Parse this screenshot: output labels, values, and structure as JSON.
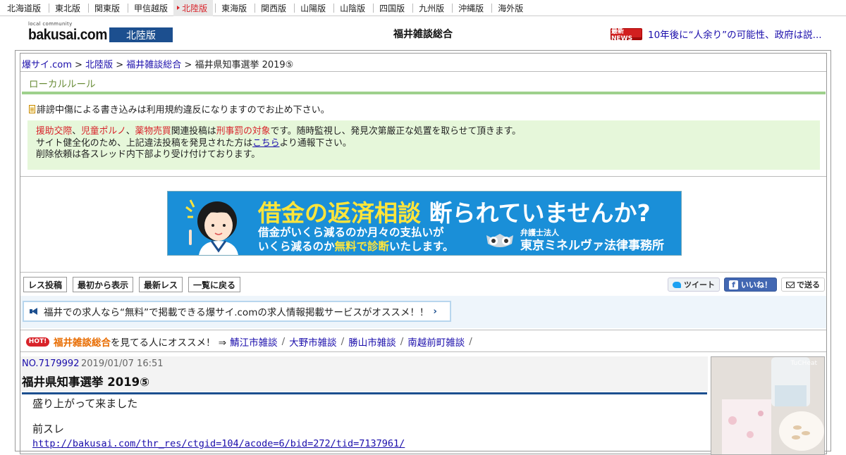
{
  "region_nav": [
    {
      "label": "北海道版",
      "active": false
    },
    {
      "label": "東北版",
      "active": false
    },
    {
      "label": "関東版",
      "active": false
    },
    {
      "label": "甲信越版",
      "active": false
    },
    {
      "label": "北陸版",
      "active": true
    },
    {
      "label": "東海版",
      "active": false
    },
    {
      "label": "関西版",
      "active": false
    },
    {
      "label": "山陽版",
      "active": false
    },
    {
      "label": "山陰版",
      "active": false
    },
    {
      "label": "四国版",
      "active": false
    },
    {
      "label": "九州版",
      "active": false
    },
    {
      "label": "沖縄版",
      "active": false
    },
    {
      "label": "海外版",
      "active": false
    }
  ],
  "header": {
    "logo_small": "local community",
    "logo_big": "bakusai.com",
    "region": "北陸版",
    "title": "福井雑談総合",
    "news_badge": "最新NEWS",
    "news_text": "10年後に“人余り”の可能性、政府は説..."
  },
  "breadcrumb": {
    "home": "爆サイ.com",
    "region": "北陸版",
    "board": "福井雑談総合",
    "sep": " > ",
    "current": "福井県知事選挙 2019⑤"
  },
  "local_rule": "ローカルルール",
  "notice": "誹謗中傷による書き込みは利用規約違反になりますのでお止め下さい。",
  "warning": {
    "w1": "援助交際",
    "comma1": "、",
    "w2": "児童ポルノ",
    "comma2": "、",
    "w3": "薬物売買",
    "mid": "関連投稿は",
    "w4": "刑事罰の対象",
    "tail": "です。随時監視し、発見次第厳正な処置を取らせて頂きます。",
    "line2_pre": "サイト健全化のため、上記違法投稿を発見された方は",
    "line2_link": "こちら",
    "line2_post": "より通報下さい。",
    "line3": "削除依頼は各スレッド内下部より受け付けております。"
  },
  "ad": {
    "head_yellow": "借金の返済相談",
    "head_white": "断られていませんか?",
    "sub1": "借金がいくら減るのか月々の支払いが",
    "sub2_pre": "いくら減るのか",
    "sub2_yellow": "無料で診断",
    "sub2_post": "いたします。",
    "firm_small": "弁護士法人",
    "firm_big": "東京ミネルヴァ法律事務所"
  },
  "actions": {
    "post": "レス投稿",
    "from_start": "最初から表示",
    "latest": "最新レス",
    "back": "一覧に戻る"
  },
  "social": {
    "tweet": "ツイート",
    "like": "いいね！",
    "send": "で送る"
  },
  "promo": "福井での求人なら“無料”で掲載できる爆サイ.comの求人情報掲載サービスがオススメ！！",
  "hot": {
    "badge": "HOT!",
    "board": "福井雑談総合",
    "text": "を見てる人にオススメ！ ⇒",
    "links": [
      "鯖江市雑談",
      "大野市雑談",
      "勝山市雑談",
      "南越前町雑談"
    ]
  },
  "post": {
    "no": "NO.7179992",
    "date": "2019/01/07 16:51",
    "title": "福井県知事選挙 2019⑤",
    "line1": "盛り上がって来ました",
    "line2": "前スレ",
    "link": "http://bakusai.com/thr_res/ctgid=104/acode=6/bid=272/tid=7137961/"
  },
  "side_ad": {
    "tag": "TuCHeat"
  },
  "colors": {
    "accent": "#1c4f8f",
    "red": "#d8232a",
    "link": "#1a0dab",
    "green": "#9ed08c"
  }
}
